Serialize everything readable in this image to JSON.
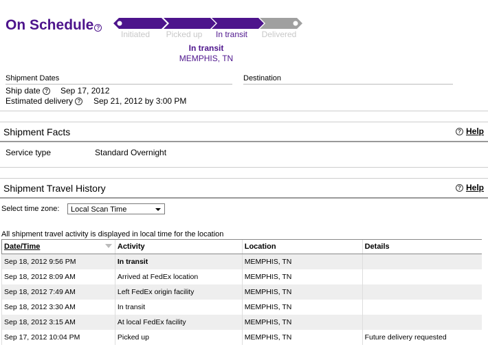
{
  "status": {
    "title": "On Schedule"
  },
  "progress": {
    "stages": [
      "Initiated",
      "Picked up",
      "In transit",
      "Delivered"
    ],
    "current_stage_index": 2,
    "current_status": "In transit",
    "current_location": "MEMPHIS, TN",
    "colors": {
      "active": "#4d148c",
      "inactive": "#a0a0a0"
    }
  },
  "dates": {
    "header": "Shipment Dates",
    "ship_date_label": "Ship date",
    "ship_date_value": "Sep 17, 2012",
    "estimated_label": "Estimated delivery",
    "estimated_value": "Sep 21, 2012 by 3:00 PM"
  },
  "destination": {
    "header": "Destination"
  },
  "facts": {
    "title": "Shipment Facts",
    "help": "Help",
    "service_label": "Service type",
    "service_value": "Standard Overnight"
  },
  "history": {
    "title": "Shipment Travel History",
    "help": "Help",
    "timezone_label": "Select time zone:",
    "timezone_selected": "Local Scan Time",
    "note": "All shipment travel activity is displayed in local time for the location",
    "columns": [
      "Date/Time",
      "Activity",
      "Location",
      "Details"
    ],
    "rows": [
      {
        "datetime": "Sep 18, 2012 9:56 PM",
        "activity": "In transit",
        "location": "MEMPHIS, TN",
        "details": ""
      },
      {
        "datetime": "Sep 18, 2012 8:09 AM",
        "activity": "Arrived at FedEx location",
        "location": "MEMPHIS, TN",
        "details": ""
      },
      {
        "datetime": "Sep 18, 2012 7:49 AM",
        "activity": "Left FedEx origin facility",
        "location": "MEMPHIS, TN",
        "details": ""
      },
      {
        "datetime": "Sep 18, 2012 3:30 AM",
        "activity": "In transit",
        "location": "MEMPHIS, TN",
        "details": ""
      },
      {
        "datetime": "Sep 18, 2012 3:15 AM",
        "activity": "At local FedEx facility",
        "location": "MEMPHIS, TN",
        "details": ""
      },
      {
        "datetime": "Sep 17, 2012 10:04 PM",
        "activity": "Picked up",
        "location": "MEMPHIS, TN",
        "details": "Future delivery requested"
      }
    ]
  }
}
